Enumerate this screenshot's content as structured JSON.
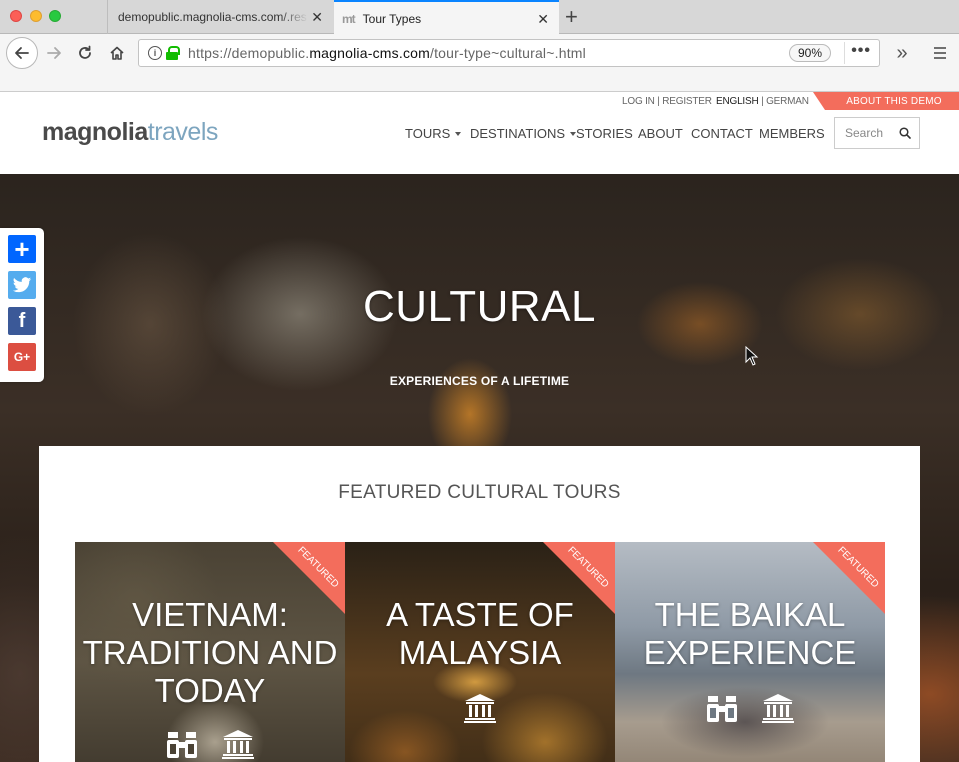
{
  "browser": {
    "tabs": [
      {
        "title": "demopublic.magnolia-cms.com/.res"
      },
      {
        "icon_text": "mt",
        "title": "Tour Types"
      }
    ],
    "url_prefix": "https://demopublic.",
    "url_domain": "magnolia-cms.com",
    "url_path": "/tour-type~cultural~.html",
    "zoom": "90%"
  },
  "header": {
    "login": "LOG IN | REGISTER",
    "lang_active": "ENGLISH",
    "lang_sep": " | ",
    "lang_other": "GERMAN",
    "about_demo": "ABOUT THIS DEMO",
    "logo_part1": "magnolia",
    "logo_part2": "travels",
    "nav": [
      "TOURS",
      "DESTINATIONS",
      "STORIES",
      "ABOUT",
      "CONTACT",
      "MEMBERS"
    ],
    "search_placeholder": "Search"
  },
  "share": {
    "googleplus": "G+",
    "facebook": "f"
  },
  "hero": {
    "title": "CULTURAL",
    "subtitle": "EXPERIENCES OF A LIFETIME"
  },
  "featured": {
    "title": "FEATURED CULTURAL TOURS",
    "cards": [
      {
        "title_lines": [
          "VIETNAM:",
          "TRADITION AND",
          "TODAY"
        ],
        "badge": "FEATURED",
        "icons": [
          "binoculars-icon",
          "museum-icon"
        ]
      },
      {
        "title_lines": [
          "A TASTE OF",
          "MALAYSIA"
        ],
        "badge": "FEATURED",
        "icons": [
          "museum-icon"
        ]
      },
      {
        "title_lines": [
          "THE BAIKAL",
          "EXPERIENCE"
        ],
        "badge": "FEATURED",
        "icons": [
          "binoculars-icon",
          "museum-icon"
        ]
      }
    ]
  },
  "colors": {
    "accent": "#f36d5c",
    "logo_grey": "#4a4a4a",
    "logo_blue": "#7da5bf",
    "firefox_blue": "#0a84ff"
  }
}
